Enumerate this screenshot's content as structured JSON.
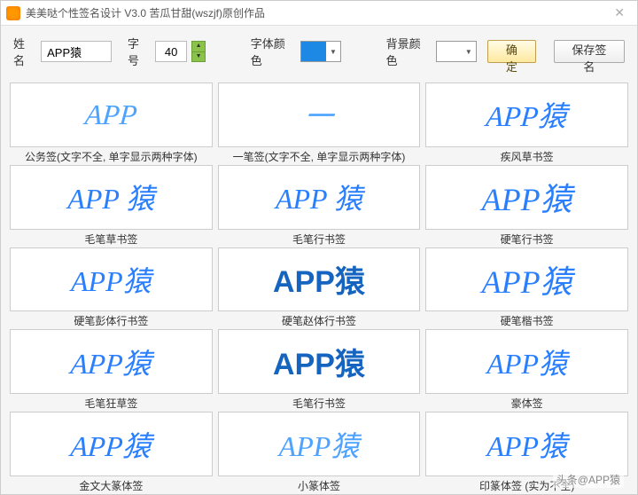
{
  "window": {
    "title": "美美哒个性签名设计 V3.0    苦瓜甘甜(wszjf)原创作品"
  },
  "toolbar": {
    "name_label": "姓名",
    "name_value": "APP猿",
    "size_label": "字号",
    "size_value": "40",
    "font_color_label": "字体颜色",
    "font_color": "#1E88E5",
    "bg_color_label": "背景颜色",
    "bg_color": "#FFFFFF",
    "confirm_label": "确定",
    "save_label": "保存签名"
  },
  "signatures": [
    {
      "text": "APP",
      "caption": "公务签(文字不全, 单字显示两种字体)",
      "style": "sig-cursive sig-light"
    },
    {
      "text": "一",
      "caption": "一笔签(文字不全, 单字显示两种字体)",
      "style": "sig-cursive sig-light"
    },
    {
      "text": "APP猿",
      "caption": "疾风草书签",
      "style": "sig-cursive"
    },
    {
      "text": "APP 猿",
      "caption": "毛笔草书签",
      "style": "sig-script"
    },
    {
      "text": "APP 猿",
      "caption": "毛笔行书签",
      "style": "sig-script"
    },
    {
      "text": "APP猿",
      "caption": "硬笔行书签",
      "style": "sig-fancy"
    },
    {
      "text": "APP猿",
      "caption": "硬笔彭体行书签",
      "style": "sig-script"
    },
    {
      "text": "APP猿",
      "caption": "硬笔赵体行书签",
      "style": "sig-bold"
    },
    {
      "text": "APP猿",
      "caption": "硬笔楷书签",
      "style": "sig-fancy"
    },
    {
      "text": "APP猿",
      "caption": "毛笔狂草签",
      "style": "sig-cursive"
    },
    {
      "text": "APP猿",
      "caption": "毛笔行书签",
      "style": "sig-bold"
    },
    {
      "text": "APP猿",
      "caption": "豪体签",
      "style": "sig-script"
    },
    {
      "text": "APP猿",
      "caption": "金文大篆体签",
      "style": "sig-cursive"
    },
    {
      "text": "APP猿",
      "caption": "小篆体签",
      "style": "sig-script sig-light"
    },
    {
      "text": "APP猿",
      "caption": "印篆体签 (实为不全)",
      "style": "sig-script"
    }
  ],
  "watermark": "头条@APP猿"
}
